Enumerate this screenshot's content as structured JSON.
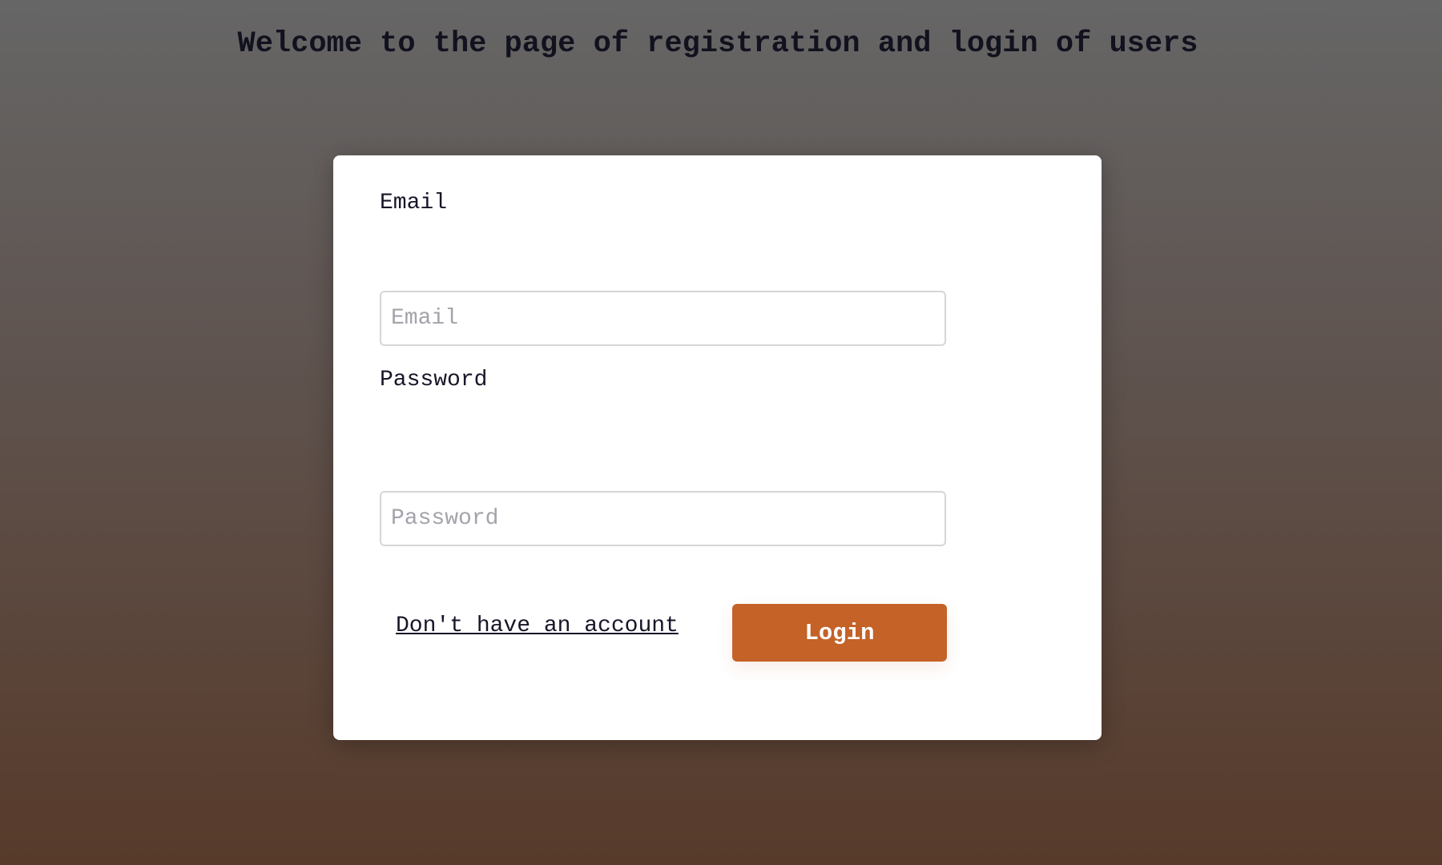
{
  "header": {
    "title": "Welcome to the page of registration and login of users"
  },
  "form": {
    "email_label": "Email",
    "email_placeholder": "Email",
    "email_value": "",
    "password_label": "Password",
    "password_placeholder": "Password",
    "password_value": "",
    "register_link": "Don't have an account",
    "login_button": "Login"
  },
  "colors": {
    "accent": "#c46228",
    "bg_top": "#666666",
    "bg_bottom": "#573a2a"
  }
}
